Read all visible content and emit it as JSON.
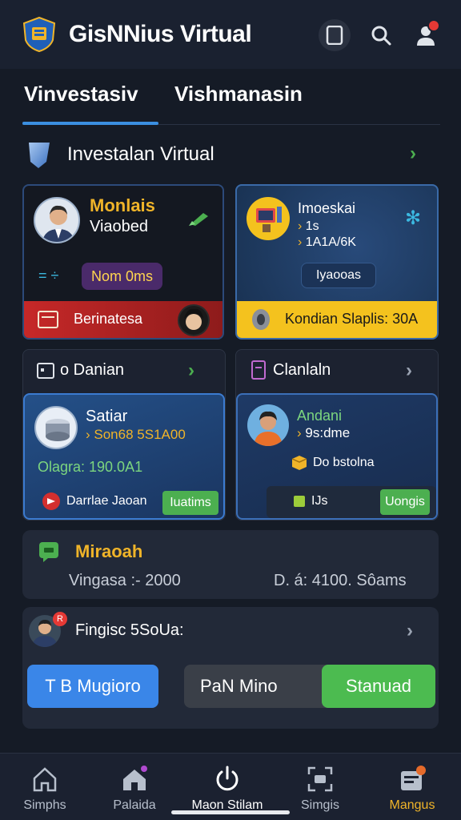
{
  "header": {
    "app_title": "GisNNius Virtual",
    "icons": [
      "shield-logo-icon",
      "tablet-icon",
      "search-icon",
      "user-icon"
    ],
    "colors": {
      "background": "#1a2130",
      "notification": "#e53935"
    }
  },
  "tabs": [
    {
      "label": "Vinvestasiv",
      "active": true
    },
    {
      "label": "Vishmanasin",
      "active": false
    }
  ],
  "section": {
    "title": "Investalan Virtual"
  },
  "cards": {
    "card1": {
      "name": "Monlais",
      "sub": "Viaobed",
      "pill": "Nom 0ms",
      "pill_prefix": "= ÷",
      "footer": "Berinatesa"
    },
    "card2": {
      "title": "Imoeskai",
      "line1": "1s",
      "line2": "1A1A/6K",
      "button": "Iyaooas",
      "footer": "Kondian Slaplis: 30A"
    },
    "card3": {
      "header": "o Danian",
      "title": "Satiar",
      "sub": "Son68 5S1A00",
      "stat": "Olagra: 190.0A1",
      "footer_text": "Darrlae Jaoan",
      "button": "Iuatims"
    },
    "card4": {
      "header": "Clanlaln",
      "title": "Andani",
      "sub": "9s:dme",
      "line": "Do bstolna",
      "footer_text": "IJs",
      "button": "Uongis"
    }
  },
  "row": {
    "title": "Miraoah",
    "left_value": "Vingasa :- 2000",
    "right_value": "D. á: 4100. Sôams"
  },
  "bottom_card": {
    "title": "Fingisc 5SoUa:",
    "button_blue": "T B Mugioro",
    "toggle_left": "PaN Mino",
    "toggle_right": "Stanuad"
  },
  "bottom_nav": [
    {
      "label": "Simphs",
      "icon": "home-icon",
      "active": false
    },
    {
      "label": "Palaida",
      "icon": "house-badge-icon",
      "active": false
    },
    {
      "label": "Maon Stilam",
      "icon": "power-icon",
      "active": false
    },
    {
      "label": "Simgis",
      "icon": "scan-icon",
      "active": false
    },
    {
      "label": "Mangus",
      "icon": "inbox-badge-icon",
      "active": true
    }
  ],
  "accent_colors": {
    "blue": "#3b8fe0",
    "green": "#4caf50",
    "yellow": "#f4c21e",
    "red": "#c62828",
    "gold_text": "#f0b429"
  }
}
